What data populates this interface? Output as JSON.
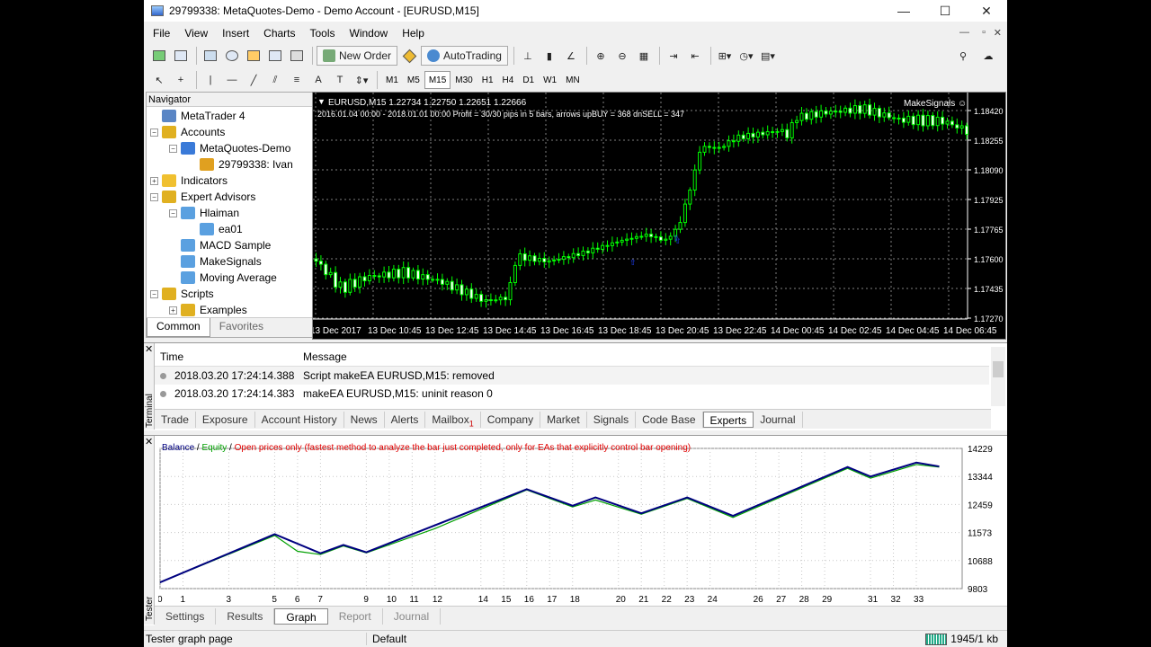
{
  "window": {
    "title": "29799338: MetaQuotes-Demo - Demo Account - [EURUSD,M15]",
    "minimize": "—",
    "maximize": "☐",
    "close": "✕"
  },
  "menu": [
    "File",
    "View",
    "Insert",
    "Charts",
    "Tools",
    "Window",
    "Help"
  ],
  "mdi_controls": [
    "—",
    "▫",
    "✕"
  ],
  "toolbar": {
    "new_order": "New Order",
    "auto_trading": "AutoTrading",
    "line_tools": [
      "A"
    ],
    "timeframes": [
      "M1",
      "M5",
      "M15",
      "M30",
      "H1",
      "H4",
      "D1",
      "W1",
      "MN"
    ],
    "active_timeframe": "M15"
  },
  "navigator": {
    "title": "Navigator",
    "close": "✕",
    "items": [
      {
        "label": "MetaTrader 4",
        "level": 0,
        "expander": "",
        "icon": "terminal-icon",
        "color": "#5a86c5"
      },
      {
        "label": "Accounts",
        "level": 0,
        "expander": "−",
        "icon": "accounts-icon",
        "color": "#e0b020"
      },
      {
        "label": "MetaQuotes-Demo",
        "level": 1,
        "expander": "−",
        "icon": "server-icon",
        "color": "#3a7ad8"
      },
      {
        "label": "29799338: Ivan",
        "level": 2,
        "expander": "",
        "icon": "user-icon",
        "color": "#e0a020"
      },
      {
        "label": "Indicators",
        "level": 0,
        "expander": "+",
        "icon": "indicators-icon",
        "color": "#f0c030"
      },
      {
        "label": "Expert Advisors",
        "level": 0,
        "expander": "−",
        "icon": "experts-icon",
        "color": "#e0b020"
      },
      {
        "label": "Hlaiman",
        "level": 1,
        "expander": "−",
        "icon": "folder-icon",
        "color": "#5aa0e0"
      },
      {
        "label": "ea01",
        "level": 2,
        "expander": "",
        "icon": "expert-icon",
        "color": "#5aa0e0"
      },
      {
        "label": "MACD Sample",
        "level": 1,
        "expander": "",
        "icon": "expert-icon",
        "color": "#5aa0e0"
      },
      {
        "label": "MakeSignals",
        "level": 1,
        "expander": "",
        "icon": "expert-icon",
        "color": "#5aa0e0"
      },
      {
        "label": "Moving Average",
        "level": 1,
        "expander": "",
        "icon": "expert-icon",
        "color": "#5aa0e0"
      },
      {
        "label": "Scripts",
        "level": 0,
        "expander": "−",
        "icon": "scripts-icon",
        "color": "#e0b020"
      },
      {
        "label": "Examples",
        "level": 1,
        "expander": "+",
        "icon": "folder-icon",
        "color": "#e0b020"
      }
    ],
    "tabs": [
      "Common",
      "Favorites"
    ],
    "active_tab": "Common"
  },
  "chart": {
    "symbol_line": "EURUSD,M15  1.22734 1.22750 1.22651 1.22666",
    "info_line": "2016.01.04 00:00 - 2018.01.01 00:00   Profit = 30/30 pips in 5 bars, arrows upBUY = 368 dnSELL = 347",
    "expert_label": "MakeSignals ☺",
    "price_labels": [
      "1.18420",
      "1.18255",
      "1.18090",
      "1.17925",
      "1.17765",
      "1.17600",
      "1.17435",
      "1.17270"
    ],
    "time_labels": [
      "13 Dec 2017",
      "13 Dec 10:45",
      "13 Dec 12:45",
      "13 Dec 14:45",
      "13 Dec 16:45",
      "13 Dec 18:45",
      "13 Dec 20:45",
      "13 Dec 22:45",
      "14 Dec 00:45",
      "14 Dec 02:45",
      "14 Dec 04:45",
      "14 Dec 06:45"
    ],
    "colors": {
      "background": "#000000",
      "bull": "#00ff00",
      "bear": "#00ff00",
      "grid": "#7f7f7f",
      "signal": "#2040ff"
    }
  },
  "terminal": {
    "side_label": "Terminal",
    "close": "✕",
    "columns": [
      "Time",
      "Message"
    ],
    "rows": [
      {
        "time": "2018.03.20 17:24:14.388",
        "message": "Script makeEA EURUSD,M15: removed"
      },
      {
        "time": "2018.03.20 17:24:14.383",
        "message": "makeEA EURUSD,M15: uninit reason 0"
      }
    ],
    "tabs": [
      "Trade",
      "Exposure",
      "Account History",
      "News",
      "Alerts",
      "Mailbox",
      "Company",
      "Market",
      "Signals",
      "Code Base",
      "Experts",
      "Journal"
    ],
    "mailbox_badge": "1",
    "active_tab": "Experts"
  },
  "tester": {
    "side_label": "Tester",
    "close": "✕",
    "legend": {
      "balance": "Balance",
      "sep1": " / ",
      "equity": "Equity",
      "sep2": " / ",
      "model": "Open prices only (fastest method to analyze the bar just completed, only for EAs that explicitly control bar opening)"
    },
    "tabs": [
      "Settings",
      "Results",
      "Graph",
      "Report",
      "Journal"
    ],
    "active_tab": "Graph",
    "colors": {
      "balance": "#000080",
      "equity": "#00a000",
      "model": "#e00000",
      "grid": "#c8c8c8"
    }
  },
  "chart_data": {
    "type": "line",
    "title": "",
    "xlabel": "",
    "ylabel": "",
    "ylim": [
      9803,
      14229
    ],
    "y_ticks": [
      14229,
      13344,
      12459,
      11573,
      10688,
      9803
    ],
    "x_ticks": [
      "0",
      "1",
      "3",
      "5",
      "6",
      "7",
      "9",
      "10",
      "11",
      "12",
      "14",
      "15",
      "16",
      "17",
      "18",
      "20",
      "21",
      "22",
      "23",
      "24",
      "26",
      "27",
      "28",
      "29",
      "31",
      "32",
      "33"
    ],
    "xlim": [
      0,
      35
    ],
    "series": [
      {
        "name": "Balance",
        "x": [
          0,
          5,
          7,
          8,
          9,
          16,
          18,
          19,
          21,
          23,
          25,
          30,
          31,
          33,
          34
        ],
        "y": [
          10000,
          11520,
          10920,
          11180,
          10950,
          12940,
          12420,
          12680,
          12180,
          12680,
          12100,
          13640,
          13340,
          13780,
          13660
        ]
      },
      {
        "name": "Equity",
        "x": [
          0,
          5,
          6,
          7,
          8,
          9,
          12,
          16,
          18,
          19,
          21,
          23,
          25,
          30,
          31,
          33,
          34
        ],
        "y": [
          10000,
          11480,
          10980,
          10880,
          11150,
          10930,
          11700,
          12920,
          12380,
          12600,
          12150,
          12650,
          12050,
          13600,
          13290,
          13720,
          13640
        ]
      }
    ]
  },
  "statusbar": {
    "page": "Tester graph page",
    "profile": "Default",
    "traffic": "1945/1 kb"
  }
}
